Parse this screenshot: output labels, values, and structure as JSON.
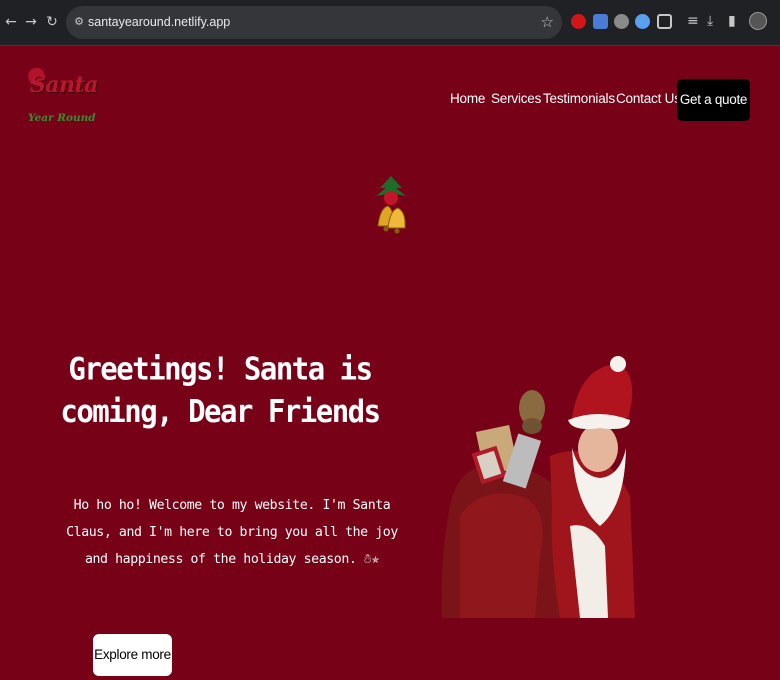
{
  "browser": {
    "url": "santayearound.netlify.app",
    "back_icon": "arrow-left-icon",
    "forward_icon": "arrow-right-icon",
    "reload_icon": "reload-icon",
    "site_info_icon": "tune-icon",
    "bookmark_icon": "star-icon",
    "extensions": [
      "red-circle-extension-icon",
      "blue-doc-extension-icon",
      "gray-circle-extension-icon",
      "blue-shield-extension-icon",
      "puzzle-icon"
    ],
    "tools": [
      "media-queue-icon",
      "download-icon",
      "sidebar-icon",
      "profile-avatar-icon"
    ]
  },
  "site": {
    "logo": {
      "line1": "Santa",
      "line2": "Year Round"
    },
    "nav": [
      "Home",
      "Services",
      "Testimonials",
      "Contact Us"
    ],
    "cta": "Get a quote",
    "hero": {
      "heading": "Greetings! Santa is coming, Dear Friends",
      "paragraph": "Ho ho ho! Welcome to my website. I'm Santa Claus, and I'm here to bring you all the joy and happiness of the holiday season. ☃✯",
      "button": "Explore more"
    }
  },
  "colors": {
    "background": "#770218",
    "cta_background": "#000000",
    "text": "#ffffff"
  }
}
